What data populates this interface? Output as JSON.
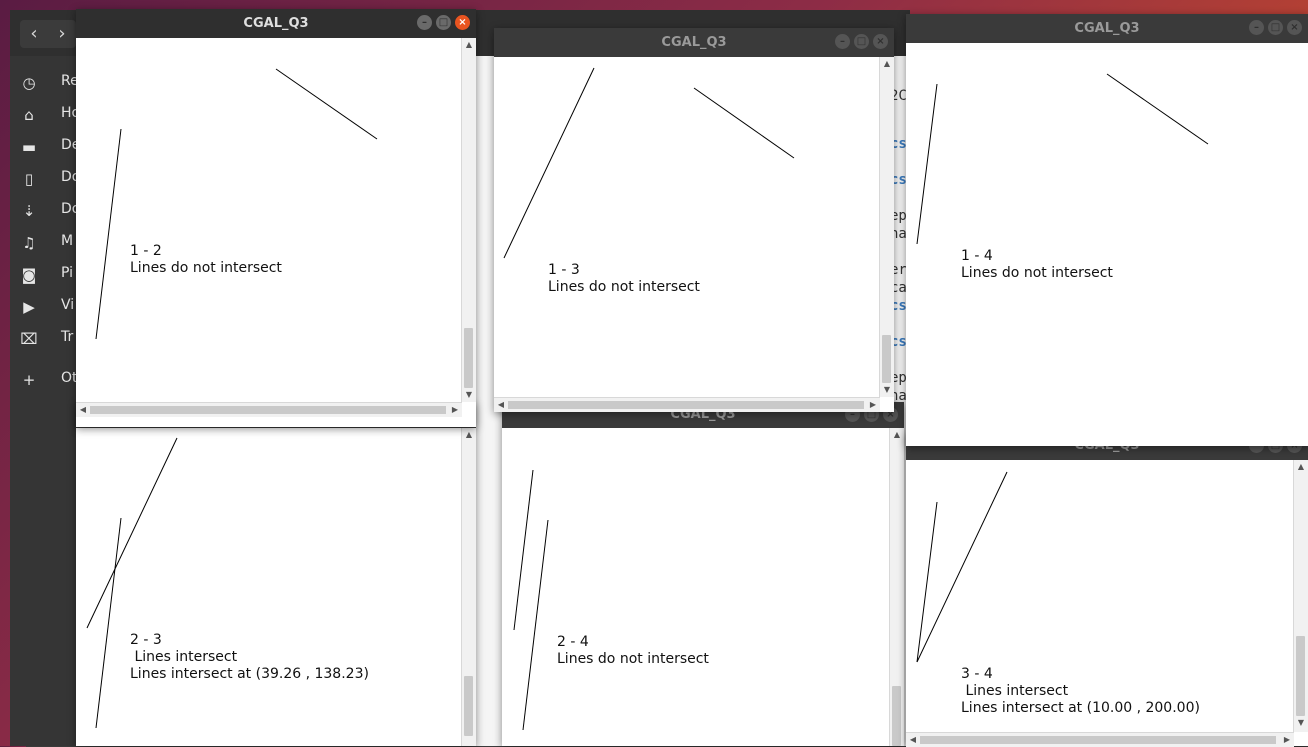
{
  "sidebar": {
    "items": [
      {
        "icon": "clock-icon",
        "glyph": "◷",
        "label": "Re"
      },
      {
        "icon": "home-icon",
        "glyph": "⌂",
        "label": "Ho"
      },
      {
        "icon": "folder-icon",
        "glyph": "▬",
        "label": "De"
      },
      {
        "icon": "document-icon",
        "glyph": "▯",
        "label": "Do"
      },
      {
        "icon": "download-icon",
        "glyph": "⇣",
        "label": "Do"
      },
      {
        "icon": "music-icon",
        "glyph": "♫",
        "label": "M"
      },
      {
        "icon": "camera-icon",
        "glyph": "◙",
        "label": "Pi"
      },
      {
        "icon": "video-icon",
        "glyph": "▶",
        "label": "Vi"
      },
      {
        "icon": "trash-icon",
        "glyph": "⌧",
        "label": "Tr"
      },
      {
        "icon": "plus-icon",
        "glyph": "+",
        "label": "Ot"
      }
    ]
  },
  "fm_nav": {
    "back": "‹",
    "forward": "›"
  },
  "code_fragments": [
    "n",
    "cs",
    "cs",
    "ep",
    "na",
    "er",
    "ca",
    "cs",
    "cs",
    "ep",
    "na",
    "2C"
  ],
  "windows": [
    {
      "id": "w12",
      "title": "CGAL_Q3",
      "label": "1 - 2",
      "line1": "Lines do not intersect",
      "line2": ""
    },
    {
      "id": "w13",
      "title": "CGAL_Q3",
      "label": "1 - 3",
      "line1": "Lines do not intersect",
      "line2": ""
    },
    {
      "id": "w14",
      "title": "CGAL_Q3",
      "label": "1 - 4",
      "line1": "Lines do not intersect",
      "line2": ""
    },
    {
      "id": "w23",
      "title": "",
      "label": "2 - 3",
      "line1": " Lines intersect",
      "line2": "Lines intersect at (39.26 , 138.23)"
    },
    {
      "id": "w24",
      "title": "CGAL_Q3",
      "label": "2 - 4",
      "line1": "Lines do not intersect",
      "line2": ""
    },
    {
      "id": "w34",
      "title": "CGAL_Q3",
      "label": "3 - 4",
      "line1": " Lines intersect",
      "line2": "Lines intersect at (10.00 , 200.00)"
    }
  ],
  "buttons": {
    "minimize": "–",
    "maximize": "□",
    "close": "×"
  },
  "scroll": {
    "up": "▲",
    "down": "▼",
    "left": "◀",
    "right": "▶"
  }
}
